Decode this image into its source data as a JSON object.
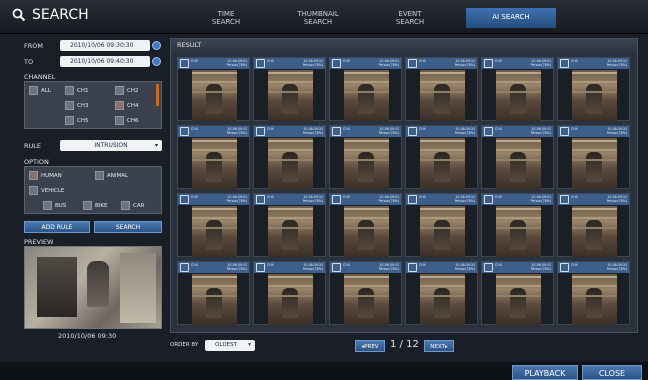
{
  "header": {
    "title": "SEARCH",
    "tabs": [
      {
        "line1": "TIME",
        "line2": "SEARCH"
      },
      {
        "line1": "THUMBNAIL",
        "line2": "SEARCH"
      },
      {
        "line1": "EVENT",
        "line2": "SEARCH"
      },
      {
        "line1": "AI SEARCH",
        "line2": ""
      }
    ]
  },
  "filters": {
    "from_label": "FROM",
    "from_value": "2010/10/06 09:30:30",
    "to_label": "TO",
    "to_value": "2010/10/06 09:40:30",
    "channel_label": "CHANNEL",
    "channels": [
      {
        "label": "ALL",
        "checked": false
      },
      {
        "label": "CH1",
        "checked": false
      },
      {
        "label": "CH2",
        "checked": false
      },
      {
        "label": "CH3",
        "checked": false
      },
      {
        "label": "CH4",
        "checked": true
      },
      {
        "label": "CH5",
        "checked": false
      },
      {
        "label": "CH6",
        "checked": false
      }
    ],
    "rule_label": "RULE",
    "rule_value": "INTRUSION",
    "option_label": "OPTION",
    "options": {
      "human": "HUMAN",
      "animal": "ANIMAL",
      "vehicle": "VEHICLE",
      "bus": "BUS",
      "bike": "BIKE",
      "car": "CAR"
    },
    "add_rule": "ADD RULE",
    "search": "SEARCH",
    "preview_label": "PREVIEW",
    "preview_time": "2010/10/06  09:30"
  },
  "result": {
    "header": "RESULT",
    "thumb_channel": "CH4",
    "thumb_date": "10-06-09:31",
    "thumb_label": "Person(78%)"
  },
  "footer": {
    "order_by_label": "ORDER BY",
    "order_value": "OLDEST",
    "prev": "PREV",
    "page": "1 / 12",
    "next": "NEXT",
    "playback": "PLAYBACK",
    "close": "CLOSE"
  }
}
